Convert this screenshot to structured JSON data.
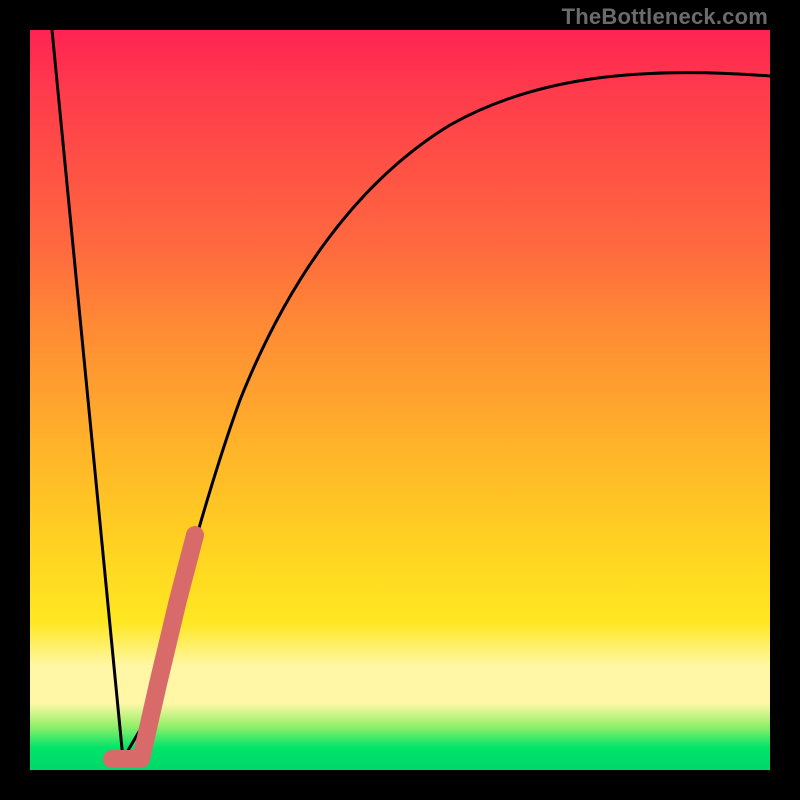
{
  "watermark": {
    "text": "TheBottleneck.com"
  },
  "colors": {
    "background": "#000000",
    "gradient_top": "#ff2353",
    "gradient_mid": "#ffd321",
    "gradient_band": "#fff7a6",
    "gradient_bottom": "#00d86a",
    "curve": "#000000",
    "highlight": "#d96a6a"
  },
  "chart_data": {
    "type": "line",
    "title": "",
    "xlabel": "",
    "ylabel": "",
    "xlim": [
      0,
      100
    ],
    "ylim": [
      0,
      100
    ],
    "series": [
      {
        "name": "bottleneck-curve",
        "x": [
          3,
          12.5,
          15,
          18,
          22,
          28,
          35,
          45,
          55,
          65,
          80,
          100
        ],
        "y": [
          100,
          1.5,
          4,
          13,
          30,
          48,
          62,
          75,
          83,
          87.5,
          91,
          93
        ]
      }
    ],
    "highlight_segment": {
      "series": "bottleneck-curve",
      "x_range": [
        11,
        22
      ],
      "note": "thick salmon marker along curve near minimum"
    },
    "annotations": []
  }
}
